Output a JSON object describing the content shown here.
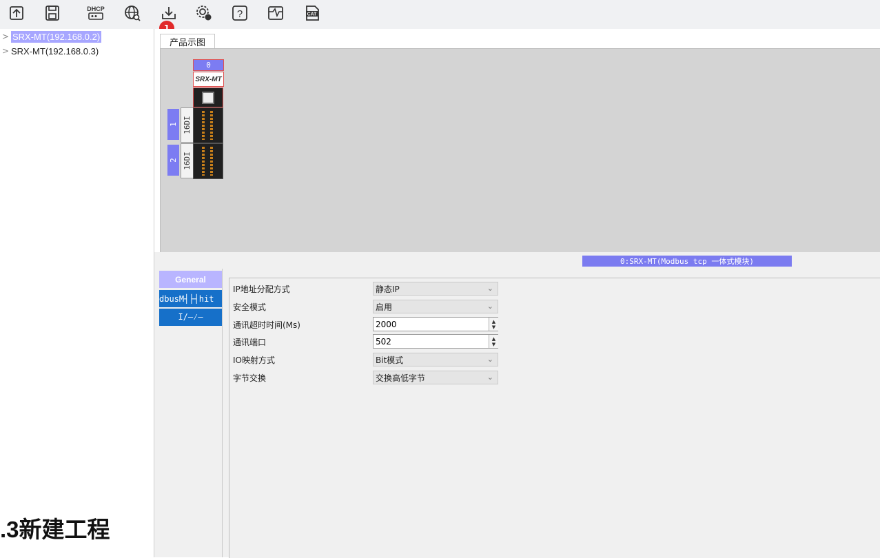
{
  "toolbar": {
    "icons": [
      "open-project-icon",
      "save-icon",
      "dhcp-icon",
      "network-scan-icon",
      "download-icon",
      "settings-icon",
      "help-icon",
      "monitor-icon",
      "cat-icon"
    ],
    "dhcp_text": "DHCP",
    "help_text": "?",
    "cat_text": "CAT",
    "badge": "1"
  },
  "tree": {
    "items": [
      {
        "label": "SRX-MT(192.168.0.2)",
        "selected": true
      },
      {
        "label": "SRX-MT(192.168.0.3)",
        "selected": false
      }
    ]
  },
  "caption": ".3新建工程",
  "product_view": {
    "tab_label": "产品示图",
    "head_module": {
      "index": "0",
      "name": "SRX-MT"
    },
    "slots": [
      {
        "index": "1",
        "type": "16DI"
      },
      {
        "index": "2",
        "type": "16DI"
      }
    ]
  },
  "status_label": "0:SRX-MT(Modbus tcp 一体式模块)",
  "side_tabs": {
    "general": "General",
    "modbus": "dbusM┤├┤hit",
    "io": "I/—⁄—"
  },
  "form": {
    "fields": [
      {
        "label": "IP地址分配方式",
        "value": "静态IP",
        "kind": "combo"
      },
      {
        "label": "安全模式",
        "value": "启用",
        "kind": "combo"
      },
      {
        "label": "通讯超时时间(Ms)",
        "value": "2000",
        "kind": "spin"
      },
      {
        "label": "通讯端口",
        "value": "502",
        "kind": "spin"
      },
      {
        "label": "IO映射方式",
        "value": "Bit模式",
        "kind": "combo"
      },
      {
        "label": "字节交换",
        "value": "交换高低字节",
        "kind": "combo"
      }
    ]
  },
  "colors": {
    "selection": "#a7a6ff",
    "module_index": "#7c7cf2",
    "side_tab_blue": "#1670c9",
    "badge_red": "#e12a2a",
    "canvas": "#d4d4d4"
  }
}
